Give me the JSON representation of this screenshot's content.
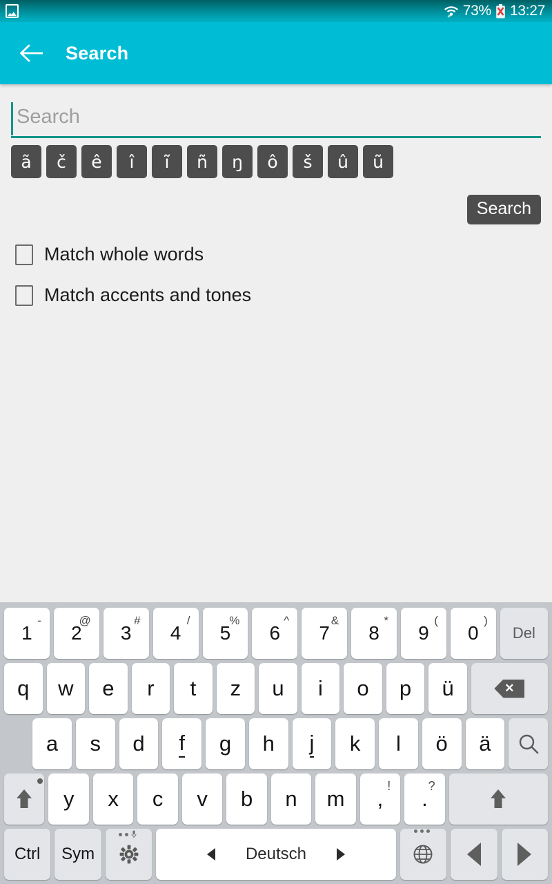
{
  "status_bar": {
    "notification_icon": "image-notification-icon",
    "wifi_icon": "wifi-icon",
    "battery_percent": "73%",
    "battery_icon": "battery-error-icon",
    "time": "13:27"
  },
  "app_bar": {
    "back_icon": "arrow-left-icon",
    "title": "Search",
    "background_color": "#00bcd4"
  },
  "search": {
    "placeholder": "Search",
    "value": "",
    "underline_color": "#109688",
    "accent_keys": [
      "ã",
      "č",
      "ê",
      "î",
      "ĩ",
      "ñ",
      "ŋ",
      "ô",
      "š",
      "û",
      "ũ"
    ],
    "search_button_label": "Search",
    "options": [
      {
        "label": "Match whole words",
        "checked": false
      },
      {
        "label": "Match accents and tones",
        "checked": false
      }
    ]
  },
  "keyboard": {
    "language": "Deutsch",
    "number_row": [
      {
        "main": "1",
        "sup": "-"
      },
      {
        "main": "2",
        "sup": "@"
      },
      {
        "main": "3",
        "sup": "#"
      },
      {
        "main": "4",
        "sup": "/"
      },
      {
        "main": "5",
        "sup": "%"
      },
      {
        "main": "6",
        "sup": "^"
      },
      {
        "main": "7",
        "sup": "&"
      },
      {
        "main": "8",
        "sup": "*"
      },
      {
        "main": "9",
        "sup": "("
      },
      {
        "main": "0",
        "sup": ")"
      }
    ],
    "del_label": "Del",
    "row_q": [
      "q",
      "w",
      "e",
      "r",
      "t",
      "z",
      "u",
      "i",
      "o",
      "p",
      "ü"
    ],
    "backspace_icon": "backspace-icon",
    "row_a": [
      "a",
      "s",
      "d",
      "f",
      "g",
      "h",
      "j",
      "k",
      "l",
      "ö",
      "ä"
    ],
    "search_key_icon": "search-icon",
    "shift_left_icon": "shift-icon",
    "row_z": [
      "y",
      "x",
      "c",
      "v",
      "b",
      "n",
      "m"
    ],
    "punctuation": [
      {
        "main": ",",
        "sup": "!"
      },
      {
        "main": ".",
        "sup": "?"
      }
    ],
    "shift_right_icon": "shift-icon",
    "ctrl_label": "Ctrl",
    "sym_label": "Sym",
    "settings_icon": "gear-icon",
    "globe_icon": "globe-icon",
    "arrow_left_icon": "arrow-left-icon",
    "arrow_right_icon": "arrow-right-icon"
  }
}
